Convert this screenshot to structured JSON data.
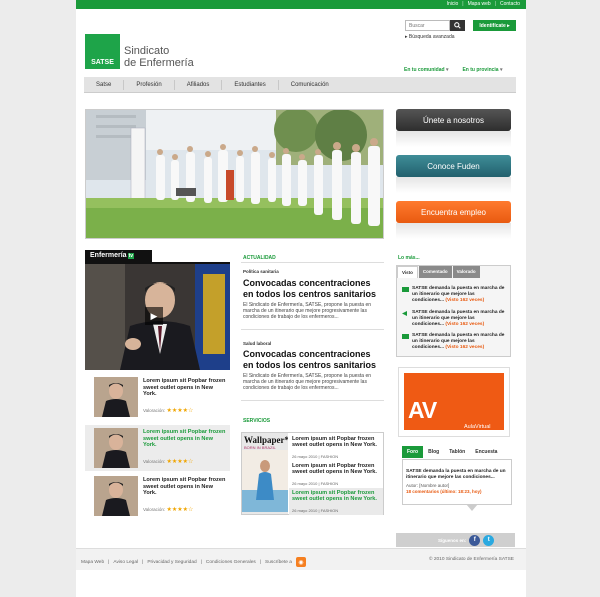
{
  "top_links": [
    "Inicio",
    "Mapa web",
    "Contacto"
  ],
  "brand": {
    "logo_text": "SATSE",
    "name_line1": "Sindicato",
    "name_line2": "de Enfermería",
    "primary_color": "#1a9a3a"
  },
  "search": {
    "placeholder": "Buscar",
    "login_label": "Identifícate",
    "advanced_label": "Búsqueda avanzada"
  },
  "regions": {
    "community": "En tu comunidad",
    "province": "En tu provincia"
  },
  "nav": [
    "Satse",
    "Profesión",
    "Afiliados",
    "Estudiantes",
    "Comunicación"
  ],
  "cta": [
    "Únete a nosotros",
    "Conoce Fuden",
    "Encuentra empleo"
  ],
  "video": {
    "header": "Enfermería",
    "header_badge": "tv",
    "items": [
      {
        "title": "Lorem ipsum sit Popbar frozen sweet outlet opens in New York.",
        "rating_label": "Valoración",
        "stars": "★★★★☆"
      },
      {
        "title": "Lorem ipsum sit Popbar frozen sweet outlet opens in New York.",
        "rating_label": "Valoración",
        "stars": "★★★★☆"
      },
      {
        "title": "Lorem ipsum sit Popbar frozen sweet outlet opens in New York.",
        "rating_label": "Valoración",
        "stars": "★★★★☆"
      }
    ]
  },
  "actualidad": {
    "title": "ACTUALIDAD",
    "items": [
      {
        "category": "Política sanitaria",
        "title": "Convocadas concentraciones en todos los centros sanitarios",
        "body": "El Sindicato de Enfermería, SATSE, propone la puesta en marcha de un itinerario que mejore progresivamente las condiciones de trabajo de los enfermeros..."
      },
      {
        "category": "Salud laboral",
        "title": "Convocadas concentraciones en todos los centros sanitarios",
        "body": "El Sindicato de Enfermería, SATSE, propone la puesta en marcha de un itinerario que mejore progresivamente las condiciones de trabajo de los enfermeros..."
      }
    ]
  },
  "servicios": {
    "title": "SERVICIOS",
    "magazine_title": "Wallpaper*",
    "magazine_sub": "BORN IN BRAZIL",
    "items": [
      {
        "title": "Lorem ipsum sit Popbar frozen sweet outlet opens in New York.",
        "date": "26 mayo 2010",
        "category": "FASHION"
      },
      {
        "title": "Lorem ipsum sit Popbar frozen sweet outlet opens in New York.",
        "date": "26 mayo 2010",
        "category": "FASHION"
      },
      {
        "title": "Lorem ipsum sit Popbar frozen sweet outlet opens in New York.",
        "date": "26 mayo 2010",
        "category": "FASHION"
      }
    ]
  },
  "lo_mas": {
    "title": "Lo más...",
    "tabs": [
      "Visto",
      "Comentado",
      "Valorado"
    ],
    "items": [
      {
        "text": "SATSE demanda la puesta en marcha de un itinerario que mejore las condiciones...",
        "count": "(Visto 162 veces)"
      },
      {
        "text": "SATSE demanda la puesta en marcha de un itinerario que mejore las condiciones...",
        "count": "(Visto 162 veces)"
      },
      {
        "text": "SATSE demanda la puesta en marcha de un itinerario que mejore las condiciones...",
        "count": "(Visto 162 veces)"
      }
    ]
  },
  "aula": {
    "logo": "AV",
    "label": "AulaVirtual"
  },
  "foro": {
    "tabs": [
      "Foro",
      "Blog",
      "Tablón",
      "Encuesta"
    ],
    "text": "SATSE demanda la puesta en marcha de un itinerario que mejore las condiciones...",
    "author": "Autor: [Nombre autor]",
    "comments": "18 comentarios (último: 18:23, hoy)"
  },
  "follow": {
    "label": "Síguenos en:",
    "facebook": "f",
    "twitter": "t"
  },
  "footer": {
    "links": [
      "Mapa Web",
      "Aviso Legal",
      "Privacidad y Seguridad",
      "Condiciones Generales",
      "Suscríbete a"
    ],
    "copyright": "© 2010 Sindicato de Enfermería SATSE"
  }
}
